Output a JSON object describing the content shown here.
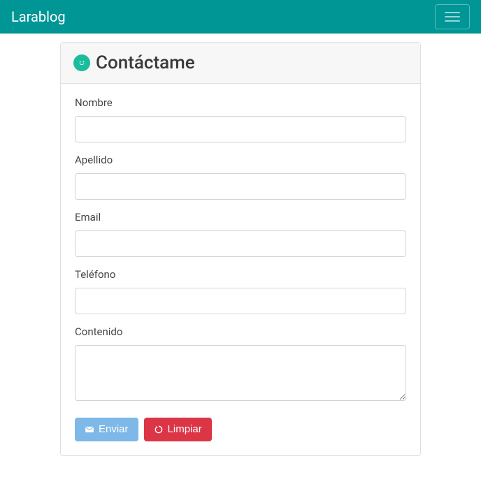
{
  "nav": {
    "brand": "Larablog"
  },
  "card": {
    "title": "Contáctame"
  },
  "form": {
    "nombre": {
      "label": "Nombre",
      "value": ""
    },
    "apellido": {
      "label": "Apellido",
      "value": ""
    },
    "email": {
      "label": "Email",
      "value": ""
    },
    "telefono": {
      "label": "Teléfono",
      "value": ""
    },
    "contenido": {
      "label": "Contenido",
      "value": ""
    }
  },
  "buttons": {
    "submit": "Enviar",
    "clear": "Limpiar"
  }
}
